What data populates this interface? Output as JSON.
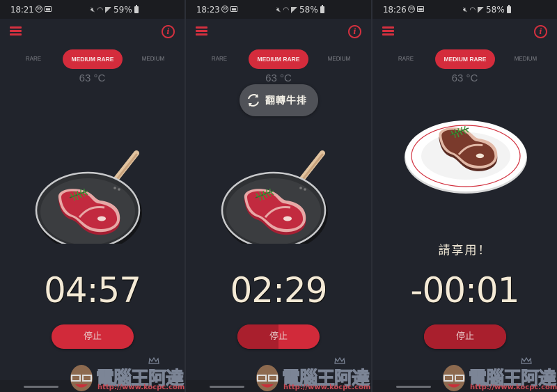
{
  "colors": {
    "background": "#21242c",
    "accent": "#d42c3c",
    "progress_fill": "#a91f2d",
    "timer_text": "#f4ead6",
    "inactive_tab": "#7e8087"
  },
  "tabs": [
    {
      "label": "RARE"
    },
    {
      "label": "MEDIUM RARE",
      "selected": true
    },
    {
      "label": "MEDIUM"
    }
  ],
  "temperature": "63 °C",
  "stop_label": "停止",
  "watermark": {
    "title": "電腦王阿達",
    "url": "http://www.kocpc.com.tw"
  },
  "screens": [
    {
      "status_bar": {
        "time": "18:21",
        "badge": "99",
        "battery": "59%"
      },
      "image": "steak-in-pan",
      "toast": null,
      "message": "",
      "timer": "04:57",
      "progress": 0.0
    },
    {
      "status_bar": {
        "time": "18:23",
        "badge": "99",
        "battery": "58%"
      },
      "image": "steak-in-pan",
      "toast": {
        "icon": "refresh-icon",
        "text": "翻轉牛排"
      },
      "message": "",
      "timer": "02:29",
      "progress": 0.5
    },
    {
      "status_bar": {
        "time": "18:26",
        "badge": "99",
        "battery": "58%"
      },
      "image": "steak-on-plate",
      "toast": null,
      "message": "請享用！",
      "timer": "-00:01",
      "progress": 1.0
    }
  ]
}
